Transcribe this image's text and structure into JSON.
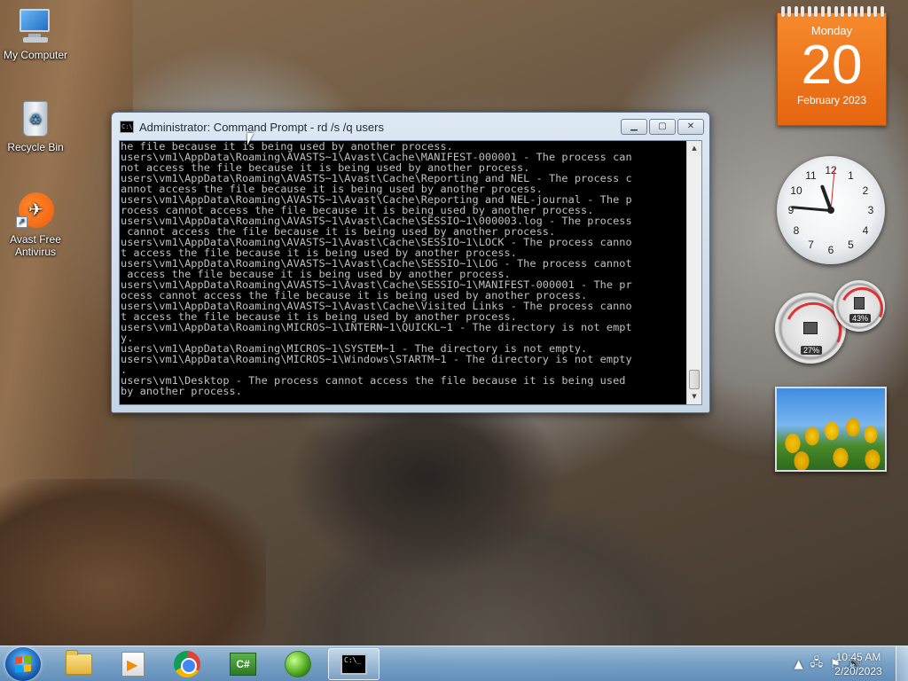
{
  "desktop": {
    "icons": [
      {
        "label": "My Computer",
        "icon": "computer-icon"
      },
      {
        "label": "Recycle Bin",
        "icon": "recycle-bin-icon"
      },
      {
        "label": "Avast Free Antivirus",
        "icon": "avast-icon"
      }
    ]
  },
  "cmd": {
    "title": "Administrator: Command Prompt - rd  /s /q users",
    "icon_text": "C:\\",
    "lines": [
      "he file because it is being used by another process.",
      "users\\vm1\\AppData\\Roaming\\AVASTS~1\\Avast\\Cache\\MANIFEST-000001 - The process can",
      "not access the file because it is being used by another process.",
      "users\\vm1\\AppData\\Roaming\\AVASTS~1\\Avast\\Cache\\Reporting and NEL - The process c",
      "annot access the file because it is being used by another process.",
      "users\\vm1\\AppData\\Roaming\\AVASTS~1\\Avast\\Cache\\Reporting and NEL-journal - The p",
      "rocess cannot access the file because it is being used by another process.",
      "users\\vm1\\AppData\\Roaming\\AVASTS~1\\Avast\\Cache\\SESSIO~1\\000003.log - The process",
      " cannot access the file because it is being used by another process.",
      "users\\vm1\\AppData\\Roaming\\AVASTS~1\\Avast\\Cache\\SESSIO~1\\LOCK - The process canno",
      "t access the file because it is being used by another process.",
      "users\\vm1\\AppData\\Roaming\\AVASTS~1\\Avast\\Cache\\SESSIO~1\\LOG - The process cannot",
      " access the file because it is being used by another process.",
      "users\\vm1\\AppData\\Roaming\\AVASTS~1\\Avast\\Cache\\SESSIO~1\\MANIFEST-000001 - The pr",
      "ocess cannot access the file because it is being used by another process.",
      "users\\vm1\\AppData\\Roaming\\AVASTS~1\\Avast\\Cache\\Visited Links - The process canno",
      "t access the file because it is being used by another process.",
      "users\\vm1\\AppData\\Roaming\\MICROS~1\\INTERN~1\\QUICKL~1 - The directory is not empt",
      "y.",
      "users\\vm1\\AppData\\Roaming\\MICROS~1\\SYSTEM~1 - The directory is not empty.",
      "users\\vm1\\AppData\\Roaming\\MICROS~1\\Windows\\STARTM~1 - The directory is not empty",
      ".",
      "users\\vm1\\Desktop - The process cannot access the file because it is being used",
      "by another process."
    ]
  },
  "gadgets": {
    "calendar": {
      "day": "Monday",
      "date": "20",
      "month": "February 2023"
    },
    "clock": {
      "numbers": [
        "12",
        "1",
        "2",
        "3",
        "4",
        "5",
        "6",
        "7",
        "8",
        "9",
        "10",
        "11"
      ]
    },
    "cpu": {
      "cpu_value": "27%",
      "memory_value": "43%"
    }
  },
  "taskbar": {
    "pinned": [
      {
        "name": "windows-explorer",
        "icon": "folder-icon"
      },
      {
        "name": "windows-media-player",
        "icon": "media-player-icon"
      },
      {
        "name": "google-chrome",
        "icon": "chrome-icon"
      },
      {
        "name": "csharp-app",
        "icon": "csharp-icon",
        "text": "C#"
      },
      {
        "name": "green-sphere-app",
        "icon": "sphere-icon"
      },
      {
        "name": "command-prompt",
        "icon": "cmd-icon",
        "active": true,
        "text": "C:\\_"
      }
    ],
    "tray": {
      "time": "10:45 AM",
      "date": "2/20/2023"
    }
  }
}
